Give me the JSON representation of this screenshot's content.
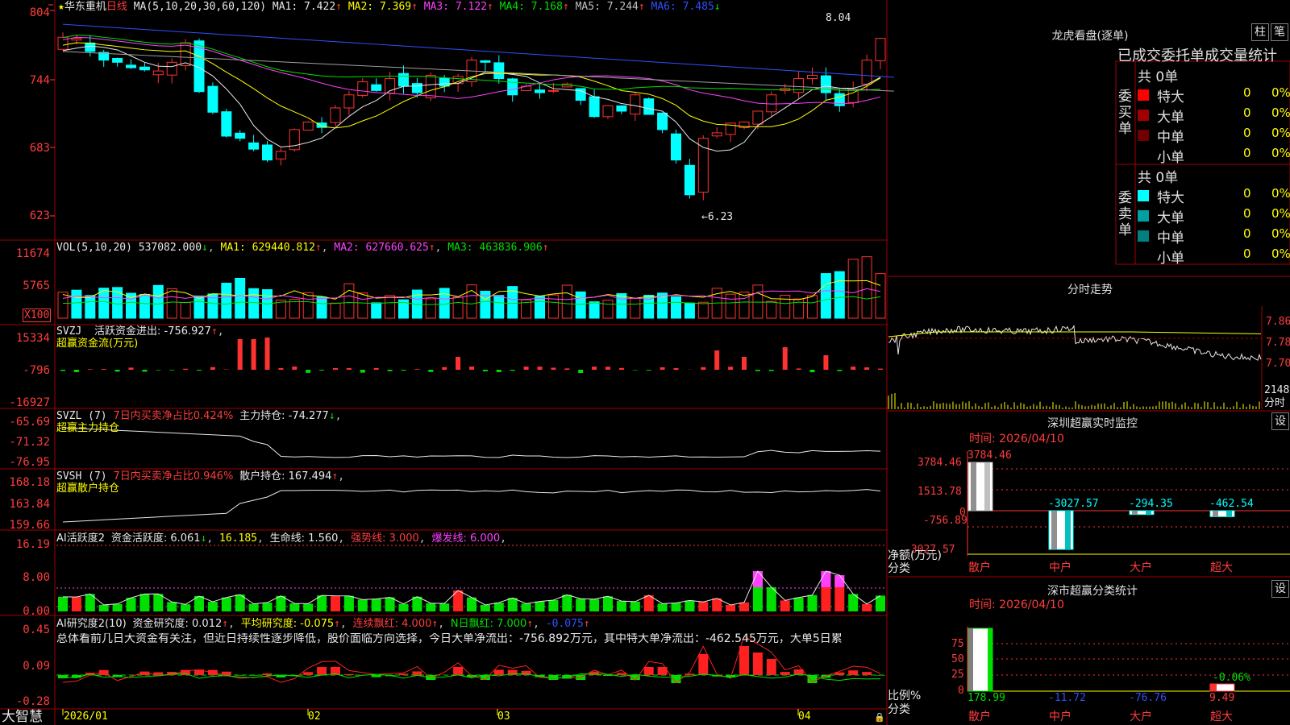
{
  "stock": {
    "name": "华东重机",
    "period": "日线",
    "star": "★"
  },
  "ma_line": {
    "label": "MA(5,10,20,30,60,120)",
    "items": [
      {
        "text": "MA1: 7.422",
        "arrow": "↑",
        "color": "#e8e8e8"
      },
      {
        "text": "MA2: 7.369",
        "arrow": "↑",
        "color": "#ffff00"
      },
      {
        "text": "MA3: 7.122",
        "arrow": "↑",
        "color": "#ff40ff"
      },
      {
        "text": "MA4: 7.168",
        "arrow": "↑",
        "color": "#00e000"
      },
      {
        "text": "MA5: 7.244",
        "arrow": "↑",
        "color": "#c0c0c0"
      },
      {
        "text": "MA6: 7.485",
        "arrow": "↓",
        "color": "#3050ff"
      }
    ]
  },
  "price_axis": [
    "804",
    "744",
    "683",
    "623"
  ],
  "price_marks": {
    "high": "8.04",
    "low": "6.23"
  },
  "vol": {
    "label": "VOL(5,10,20)",
    "value": "537082.000",
    "value_arrow": "↓",
    "ma1": "MA1: 629440.812",
    "ma2": "MA2: 627660.625",
    "ma3": "MA3: 463836.906",
    "axis": [
      "11674",
      "5765"
    ],
    "unit": "X100"
  },
  "svzj": {
    "label": "SVZJ",
    "title": "活跃资金进出: -756.927",
    "arrow": "↑",
    "sub": "超赢资金流(万元)",
    "axis": [
      "15334",
      "-796",
      "-16927"
    ]
  },
  "svzl": {
    "label": "SVZL (7)",
    "ratio": "7日内买卖净占比0.424%",
    "hold": "主力持仓: -74.277",
    "arrow": "↓",
    "sub": "超赢主力持仓",
    "axis": [
      "-65.69",
      "-71.32",
      "-76.95"
    ]
  },
  "svsh": {
    "label": "SVSH (7)",
    "ratio": "7日内买卖净占比0.946%",
    "hold": "散户持仓: 167.494",
    "arrow": "↑",
    "sub": "超赢散户持仓",
    "axis": [
      "168.18",
      "163.84",
      "159.66"
    ]
  },
  "ai2": {
    "label": "AI活跃度2",
    "active": "资金活跃度: 6.061",
    "a_arrow": "↓",
    "v2": "16.185",
    "life": "生命线: 1.560",
    "strong": "强势线: 3.000",
    "burst": "爆发线: 6.000",
    "axis": [
      "16.19",
      "8.00",
      "0.00"
    ]
  },
  "ai_res": {
    "label": "AI研究度2(10)",
    "res": "资金研究度: 0.012",
    "avg": "平均研究度: -0.075",
    "lian": "连续飘红: 4.000",
    "nday": "N日飘红: 7.000",
    "last": "-0.075",
    "axis": [
      "0.45",
      "0.09",
      "-0.28"
    ],
    "summary": "总体看前几日大资金有关注，但近日持续性逐步降低，股价面临方向选择，今日大单净流出：-756.892万元，其中特大单净流出：-462.545万元，大单5日累"
  },
  "dates": [
    "2026/01",
    "02",
    "03",
    "04"
  ],
  "brand": "大智慧",
  "lhb": {
    "title": "龙虎看盘(逐单)",
    "btn1": "柱",
    "btn2": "笔",
    "stat_title": "已成交委托单成交量统计",
    "buy_label": "委买单",
    "sell_label": "委卖单",
    "total_buy": "共 0单",
    "total_sell": "共 0单",
    "rows": [
      {
        "name": "特大",
        "v": "0",
        "p": "0%"
      },
      {
        "name": "大单",
        "v": "0",
        "p": "0%"
      },
      {
        "name": "中单",
        "v": "0",
        "p": "0%"
      },
      {
        "name": "小单",
        "v": "0",
        "p": "0%"
      }
    ]
  },
  "intraday": {
    "title": "分时走势",
    "axis": [
      "7.86",
      "7.78",
      "7.70"
    ],
    "vol": "2148",
    "time": "分时"
  },
  "sz_monitor": {
    "title": "深圳超赢实时监控",
    "btn": "设",
    "date": "时间: 2026/04/10",
    "axis": [
      "3784.46",
      "1513.78",
      "0",
      "-756.89",
      "-3027.57"
    ],
    "bars": [
      {
        "name": "散户",
        "v": "3784.46"
      },
      {
        "name": "中户",
        "v": "-3027.57"
      },
      {
        "name": "大户",
        "v": "-294.35"
      },
      {
        "name": "超大",
        "v": "-462.54"
      }
    ],
    "ylabel": "净额(万元)",
    "xlabel": "分类"
  },
  "sz_stats": {
    "title": "深市超赢分类统计",
    "btn": "设",
    "date": "时间: 2026/04/10",
    "axis": [
      "75",
      "50",
      "25",
      "0"
    ],
    "bars": [
      {
        "name": "散户",
        "v": "178.99"
      },
      {
        "name": "中户",
        "v": "-11.72"
      },
      {
        "name": "大户",
        "v": "-76.76"
      },
      {
        "name": "超大",
        "v": "9.49"
      }
    ],
    "top_label": "-0.06%",
    "ylabel": "比例%",
    "xlabel": "分类"
  },
  "colors": {
    "up": "#ff3232",
    "down": "#00ffff",
    "grid": "#a00000",
    "axis": "#ff3c3c"
  }
}
